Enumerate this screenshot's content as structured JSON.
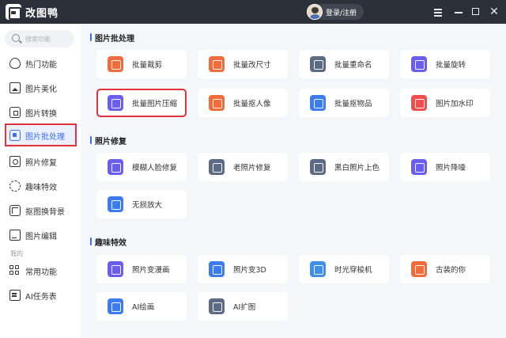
{
  "app": {
    "title": "改图鸭",
    "login_label": "登录/注册"
  },
  "sidebar": {
    "search_placeholder": "搜索功能",
    "items": [
      {
        "label": "热门功能",
        "icon": "fire-icon"
      },
      {
        "label": "图片美化",
        "icon": "image-icon"
      },
      {
        "label": "图片转换",
        "icon": "convert-icon"
      },
      {
        "label": "图片批处理",
        "icon": "batch-icon",
        "active": true
      },
      {
        "label": "照片修复",
        "icon": "repair-icon"
      },
      {
        "label": "趣味特效",
        "icon": "sparkle-icon"
      },
      {
        "label": "抠图换背景",
        "icon": "cutout-icon"
      },
      {
        "label": "图片编辑",
        "icon": "edit-icon"
      }
    ],
    "mine_label": "我的",
    "mine_items": [
      {
        "label": "常用功能",
        "icon": "grid-icon"
      },
      {
        "label": "AI任务表",
        "icon": "ai-task-icon"
      }
    ]
  },
  "sections": [
    {
      "title": "图片批处理",
      "cards": [
        {
          "label": "批量裁剪",
          "color": "#f26b3a"
        },
        {
          "label": "批量改尺寸",
          "color": "#f26b3a"
        },
        {
          "label": "批量重命名",
          "color": "#5b6a85"
        },
        {
          "label": "批量旋转",
          "color": "#6a5ef0"
        },
        {
          "label": "批量图片压缩",
          "color": "#6a5ef0",
          "highlighted": true
        },
        {
          "label": "批量抠人像",
          "color": "#f26b3a"
        },
        {
          "label": "批量抠物品",
          "color": "#3d7bf0"
        },
        {
          "label": "图片加水印",
          "color": "#ee4e4e"
        }
      ]
    },
    {
      "title": "照片修复",
      "cards": [
        {
          "label": "模糊人脸修复",
          "color": "#6a5ef0"
        },
        {
          "label": "老照片修复",
          "color": "#5b6a85"
        },
        {
          "label": "黑白照片上色",
          "color": "#5b6a85"
        },
        {
          "label": "照片降噪",
          "color": "#6a5ef0"
        },
        {
          "label": "无损放大",
          "color": "#3d7bf0"
        }
      ]
    },
    {
      "title": "趣味特效",
      "cards": [
        {
          "label": "照片变漫画",
          "color": "#6a5ef0"
        },
        {
          "label": "照片变3D",
          "color": "#3d7bf0"
        },
        {
          "label": "时光穿梭机",
          "color": "#3f8fe8"
        },
        {
          "label": "古装的你",
          "color": "#f26b3a"
        },
        {
          "label": "AI绘画",
          "color": "#3d7bf0"
        },
        {
          "label": "AI扩图",
          "color": "#5b6a85"
        }
      ]
    }
  ],
  "colors": {
    "accent": "#3a6df0",
    "highlight_border": "#e0323a",
    "titlebar": "#2b3039"
  }
}
